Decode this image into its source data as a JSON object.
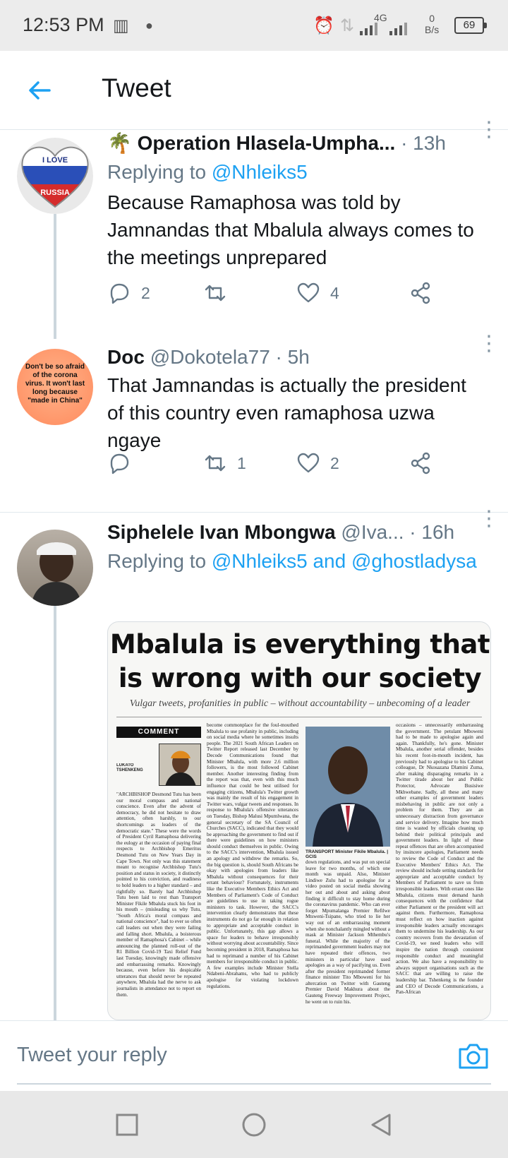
{
  "status_bar": {
    "time": "12:53 PM",
    "network": "4G",
    "speed_value": "0",
    "speed_unit": "B/s",
    "battery": "69"
  },
  "header": {
    "title": "Tweet"
  },
  "tweets": [
    {
      "emoji": "🌴",
      "name": "Operation Hlasela-Umpha...",
      "handle": "",
      "time": "· 13h",
      "reply_prefix": "Replying to ",
      "reply_to": "@Nhleiks5",
      "text": "Because Ramaphosa was told by Jamnandas that Mbalula always comes to the meetings unprepared",
      "avatar_line1": "I LOVE",
      "avatar_line2": "RUSSIA",
      "replies": "2",
      "retweets": "",
      "likes": "4"
    },
    {
      "name": "Doc",
      "handle": "@Dokotela77",
      "time": " · 5h",
      "text": "That Jamnandas is actually the president of this country even ramaphosa uzwa ngaye",
      "avatar_text": "Don't be so afraid of the corona virus. It won't last long because \"made in China\"",
      "replies": "",
      "retweets": "1",
      "likes": "2"
    },
    {
      "name": "Siphelele Ivan Mbongwa",
      "handle": "@Iva...",
      "time": " · 16h",
      "reply_prefix": "Replying to ",
      "reply_to": "@Nhleiks5 and @ghostladysa"
    }
  ],
  "newspaper": {
    "headline": "Mbalula is everything that is wrong with our society",
    "subhead": "Vulgar tweets, profanities in public – without accountability – unbecoming of a leader",
    "comment_tag": "COMMENT",
    "author": "LUKATO TSHENKENG",
    "caption": "TRANSPORT Minister Fikile Mbalula. | GCIS",
    "col1": "\"ARCHBISHOP Desmond Tutu has been our moral compass and national conscience. Even after the advent of democracy, he did not hesitate to draw attention, often harshly, to our shortcomings as leaders of the democratic state.\" These were the words of President Cyril Ramaphosa delivering the eulogy at the occasion of paying final respects to Archbishop Emeritus Desmond Tutu on New Years Day in Cape Town. Not only was this statement meant to recognise Archbishop Tutu's position and status in society, it distinctly pointed to his conviction, and readiness to hold leaders to a higher standard – and rightfully so. Barely had Archbishop Tutu been laid to rest than Transport Minister Fikile Mbalula stuck his foot in his mouth – (misleading us why Tutu, \"South Africa's moral compass and national conscience\", had to ever so often call leaders out when they were failing and falling short. Mbalula, a boisterous member of Ramaphosa's Cabinet – while announcing the planned roll-out of the R1 Billion Covid-19 Taxi Relief Fund last Tuesday, knowingly made offensive and embarrassing remarks. Knowingly because, even before his despicable utterances that should never be repeated anywhere, Mbalula had the nerve to ask journalists in attendance not to report on them.",
    "col2": "become commonplace for the foul-mouthed Mbalula to use profanity in public, including on social media where he sometimes insults people. The 2021 South African Leaders on Twitter Report released last December by Decode Communications found that Minister Mbalula, with more 2.6 million followers, is the most followed Cabinet member. Another interesting finding from the report was that, even with this much influence that could be best utilised for engaging citizens, Mbalula's Twitter growth was mainly the result of his engagement in Twitter wars, vulgar tweets and responses. In response to Mbalula's offensive utterances on Tuesday, Bishop Malusi Mpumlwana, the general secretary of the SA Council of Churches (SACC), indicated that they would be approaching the government to find out if there were guidelines on how ministers should conduct themselves in public. Owing to the SACC's intervention, Mbalula issued an apology and withdrew the remarks. So, the big question is, should South Africans be okay with apologies from leaders like Mbalula without consequences for their errant behaviour? Fortunately, instruments like the Executive Members Ethics Act and Members of Parliament's Code of Conduct are guidelines to use in taking rogue ministers to task. However, the SACC's intervention clearly demonstrates that these instruments do not go far enough in relation to appropriate and acceptable conduct in public. Unfortunately, this gap allows a space for leaders to behave irresponsibly without worrying about accountability. Since becoming president in 2018, Ramaphosa has had to reprimand a number of his Cabinet members for irresponsible conduct in public. A few examples include Minister Stella Ndabeni-Abrahams, who had to publicly apologise for violating lockdown regulations.",
    "col3": "down regulations, and was put on special leave for two months, of which one month was unpaid. Also, Minister Lindiwe Zulu had to apologise for a video posted on social media showing her out and about and asking about finding it difficult to stay home during the coronavirus pandemic. Who can ever forget Mpumalanga Premier Refilwe Mtsweni-Tsipane, who tried to lie her way out of an embarrassing moment when she nonchalantly mingled without a mask at Minister Jackson Mthembu's funeral. While the majority of the reprimanded government leaders may not have repeated their offences, two ministers in particular have used apologies as a way of pacifying us. Even after the president reprimanded former finance minister Tito Mboweni for his altercation on Twitter with Gauteng Premier David Makhura about the Gauteng Freeway Improvement Project, he went on to ruin his.",
    "col4": "occasions – unnecessarily embarrassing the government. The petulant Mboweni had to be made to apologise again and again. Thankfully, he's gone. Minister Mbalula, another serial offender, besides his recent foot-in-mouth incident, has previously had to apologise to his Cabinet colleague, Dr Nkosazana Dlamini Zuma, after making disparaging remarks in a Twitter tirade about her and Public Protector, Advocate Busisiwe Mkhwebane. Sadly, all these and many other examples of government leaders misbehaving in public are not only a problem for them. They are an unnecessary distraction from governance and service delivery. Imagine how much time is wasted by officials cleaning up behind their political principals and government leaders. In light of these repeat offences that are often accompanied by insincere apologies, Parliament needs to review the Code of Conduct and the Executive Members' Ethics Act. The review should include setting standards for appropriate and acceptable conduct by Members of Parliament to save us from irresponsible leaders. With errant ones like Mbalula, citizens must demand harsh consequences with the confidence that either Parliament or the president will act against them. Furthermore, Ramaphosa must reflect on how inaction against irresponsible leaders actually encourages them to undermine his leadership. As our country recovers from the devastation of Covid-19, we need leaders who will inspire the nation through consistent responsible conduct and meaningful action. We also have a responsibility to always support organisations such as the SACC that are willing to raise the leadership bar. Tshenkeng is the founder and CEO of Decode Communications, a Pan-African"
  },
  "reply_bar": {
    "placeholder": "Tweet your reply"
  },
  "colors": {
    "accent": "#1da1f2",
    "secondary_text": "#657786",
    "divider": "#e1e8ed"
  }
}
